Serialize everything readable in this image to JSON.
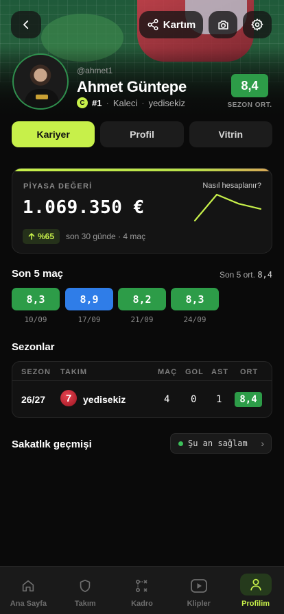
{
  "header": {
    "share_label": "Kartım"
  },
  "profile": {
    "handle": "@ahmet1",
    "name": "Ahmet Güntepe",
    "league_badge": "C",
    "rank": "#1",
    "position": "Kaleci",
    "team": "yedisekiz",
    "season_avg": "8,4",
    "season_avg_label": "SEZON ORT."
  },
  "tabs": [
    {
      "label": "Kariyer",
      "active": true
    },
    {
      "label": "Profil",
      "active": false
    },
    {
      "label": "Vitrin",
      "active": false
    }
  ],
  "market": {
    "label": "PİYASA DEĞERİ",
    "how_link": "Nasıl hesaplanır?",
    "amount": "1.069.350 €",
    "change": "%65",
    "period": "son 30 günde · 4 maç",
    "trend": [
      1,
      3,
      2.3,
      1.9
    ]
  },
  "last5": {
    "title": "Son 5 maç",
    "avg_label": "Son 5 ort.",
    "avg_value": "8,4",
    "matches": [
      {
        "score": "8,3",
        "date": "10/09",
        "color": "#2d9c48"
      },
      {
        "score": "8,9",
        "date": "17/09",
        "color": "#2f7de8"
      },
      {
        "score": "8,2",
        "date": "21/09",
        "color": "#2d9c48"
      },
      {
        "score": "8,3",
        "date": "24/09",
        "color": "#2d9c48"
      }
    ]
  },
  "seasons": {
    "title": "Sezonlar",
    "headers": {
      "season": "SEZON",
      "team": "TAKIM",
      "matches": "MAÇ",
      "goals": "GOL",
      "assists": "AST",
      "avg": "ORT"
    },
    "rows": [
      {
        "season": "26/27",
        "team_logo": "7",
        "team": "yedisekiz",
        "matches": "4",
        "goals": "0",
        "assists": "1",
        "avg": "8,4"
      }
    ]
  },
  "injury": {
    "title": "Sakatlık geçmişi",
    "status": "Şu an sağlam"
  },
  "nav": [
    {
      "label": "Ana Sayfa",
      "icon": "home-icon"
    },
    {
      "label": "Takım",
      "icon": "shield-icon"
    },
    {
      "label": "Kadro",
      "icon": "tactics-icon"
    },
    {
      "label": "Klipler",
      "icon": "play-icon"
    },
    {
      "label": "Profilim",
      "icon": "user-icon",
      "active": true
    }
  ],
  "colors": {
    "accent": "#c7f04a",
    "rating_green": "#2d9c48",
    "rating_blue": "#2f7de8"
  }
}
